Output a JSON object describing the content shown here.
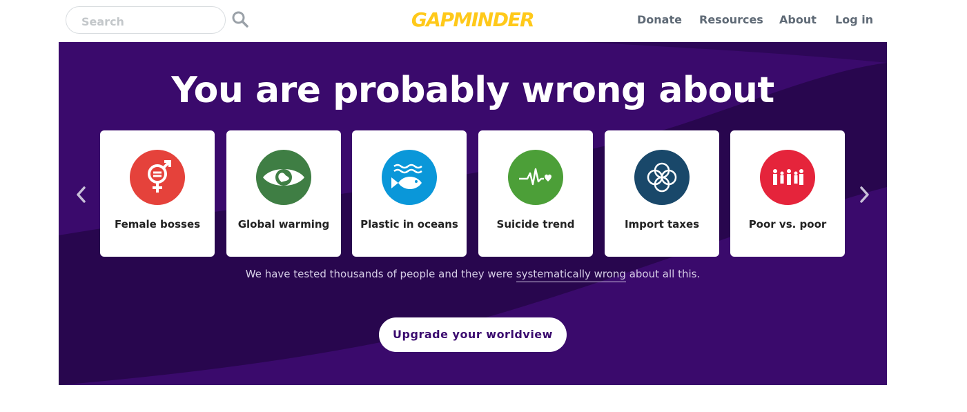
{
  "header": {
    "search_placeholder": "Search",
    "logo_text": "GAPMINDER",
    "nav": {
      "donate": "Donate",
      "resources": "Resources",
      "about": "About",
      "login": "Log in"
    }
  },
  "hero": {
    "title": "You are probably wrong about",
    "cards": [
      {
        "label": "Female bosses",
        "icon": "gender-equality-icon",
        "color": "#e5423b"
      },
      {
        "label": "Global warming",
        "icon": "eye-globe-icon",
        "color": "#3f7e44"
      },
      {
        "label": "Plastic in oceans",
        "icon": "fish-waves-icon",
        "color": "#0a97d9"
      },
      {
        "label": "Suicide trend",
        "icon": "heartbeat-icon",
        "color": "#4c9f38"
      },
      {
        "label": "Import taxes",
        "icon": "flower-rings-icon",
        "color": "#19486a"
      },
      {
        "label": "Poor vs. poor",
        "icon": "family-icon",
        "color": "#e5243b"
      }
    ],
    "tagline_before": "We have tested thousands of people and they were ",
    "tagline_link": "systematically wrong",
    "tagline_after": " about all this.",
    "cta_label": "Upgrade your worldview"
  },
  "colors": {
    "hero_bg": "#3b0b6f",
    "hero_dark": "#2a0650",
    "logo": "#ffc91a",
    "nav_text": "#5f6a76"
  }
}
